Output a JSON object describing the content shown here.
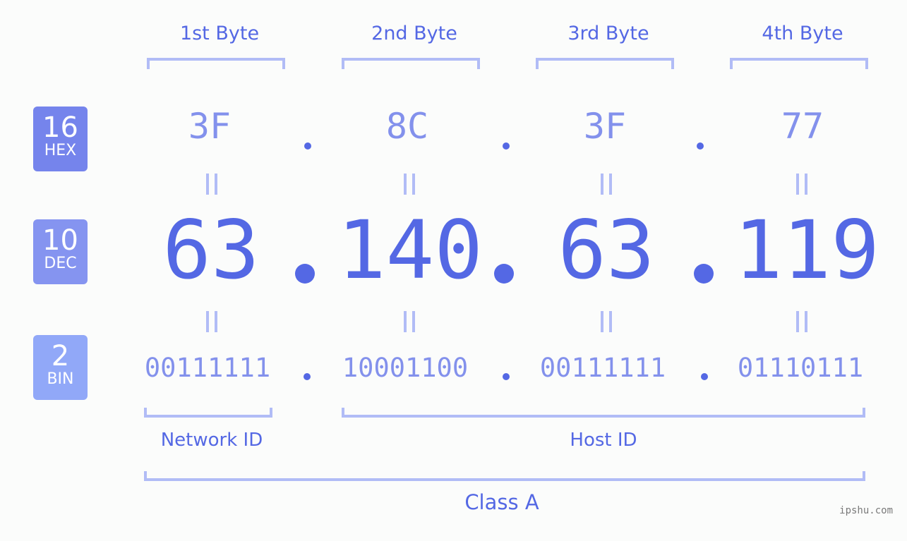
{
  "bytes": [
    {
      "label": "1st Byte",
      "hex": "3F",
      "dec": "63",
      "bin": "00111111"
    },
    {
      "label": "2nd Byte",
      "hex": "8C",
      "dec": "140",
      "bin": "10001100"
    },
    {
      "label": "3rd Byte",
      "hex": "3F",
      "dec": "63",
      "bin": "00111111"
    },
    {
      "label": "4th Byte",
      "hex": "77",
      "dec": "119",
      "bin": "01110111"
    }
  ],
  "badges": {
    "hex": {
      "num": "16",
      "name": "HEX",
      "color": "#7584ec"
    },
    "dec": {
      "num": "10",
      "name": "DEC",
      "color": "#8594f0"
    },
    "bin": {
      "num": "2",
      "name": "BIN",
      "color": "#91a8f8"
    }
  },
  "segments": {
    "network": "Network ID",
    "host": "Host ID",
    "class": "Class A"
  },
  "watermark": "ipshu.com",
  "colors": {
    "accent": "#5468e4",
    "light": "#8391ec",
    "bracket": "#b1bcf6"
  }
}
